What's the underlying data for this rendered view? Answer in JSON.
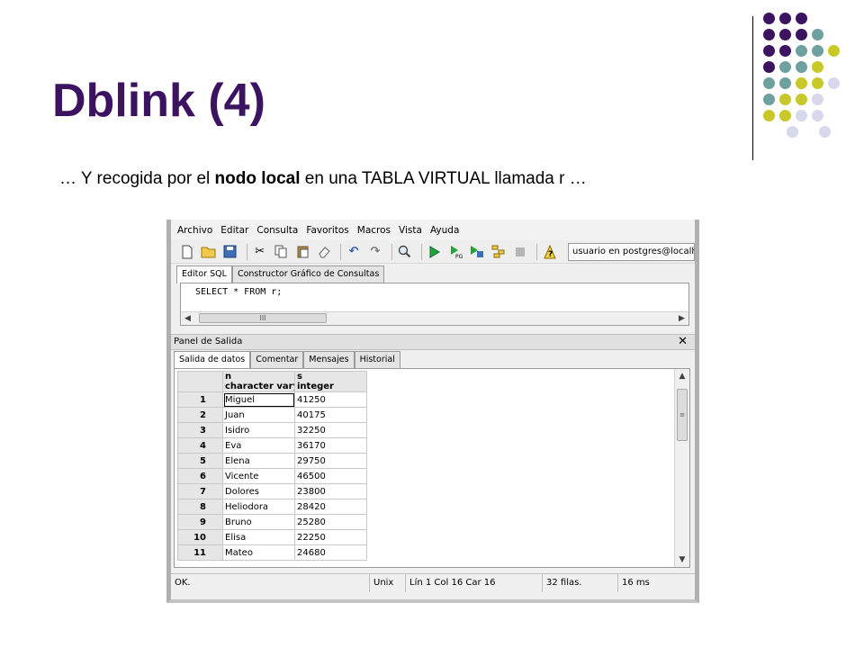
{
  "slide": {
    "title": "Dblink (4)",
    "subtitle_pre": "… Y recogida por el ",
    "subtitle_bold": "nodo local",
    "subtitle_post": " en una TABLA VIRTUAL llamada r …",
    "dot_colors": [
      "#3c1361",
      "#6fa0a0",
      "#c8c82a",
      "#d8d8ec"
    ]
  },
  "app": {
    "menu": [
      "Archivo",
      "Editar",
      "Consulta",
      "Favoritos",
      "Macros",
      "Vista",
      "Ayuda"
    ],
    "connection": "usuario en postgres@localhost",
    "editor_tabs": [
      "Editor SQL",
      "Constructor Gráfico de Consultas"
    ],
    "sql_query": "SELECT * FROM r;",
    "scroll_grip": "III",
    "output_panel_title": "Panel de Salida",
    "close_glyph": "✕",
    "output_tabs": [
      "Salida de datos",
      "Comentar",
      "Mensajes",
      "Historial"
    ],
    "columns": [
      {
        "name": "n",
        "type": "character varying"
      },
      {
        "name": "s",
        "type": "integer"
      }
    ],
    "rows": [
      {
        "num": "1",
        "n": "Miguel",
        "s": "41250"
      },
      {
        "num": "2",
        "n": "Juan",
        "s": "40175"
      },
      {
        "num": "3",
        "n": "Isidro",
        "s": "32250"
      },
      {
        "num": "4",
        "n": "Eva",
        "s": "36170"
      },
      {
        "num": "5",
        "n": "Elena",
        "s": "29750"
      },
      {
        "num": "6",
        "n": "Vicente",
        "s": "46500"
      },
      {
        "num": "7",
        "n": "Dolores",
        "s": "23800"
      },
      {
        "num": "8",
        "n": "Heliodora",
        "s": "28420"
      },
      {
        "num": "9",
        "n": "Bruno",
        "s": "25280"
      },
      {
        "num": "10",
        "n": "Elisa",
        "s": "22250"
      },
      {
        "num": "11",
        "n": "Mateo",
        "s": "24680"
      }
    ],
    "status": {
      "state": "OK.",
      "line_ending": "Unix",
      "position": "Lín 1 Col 16 Car 16",
      "rows": "32 filas.",
      "time": "16 ms"
    }
  }
}
